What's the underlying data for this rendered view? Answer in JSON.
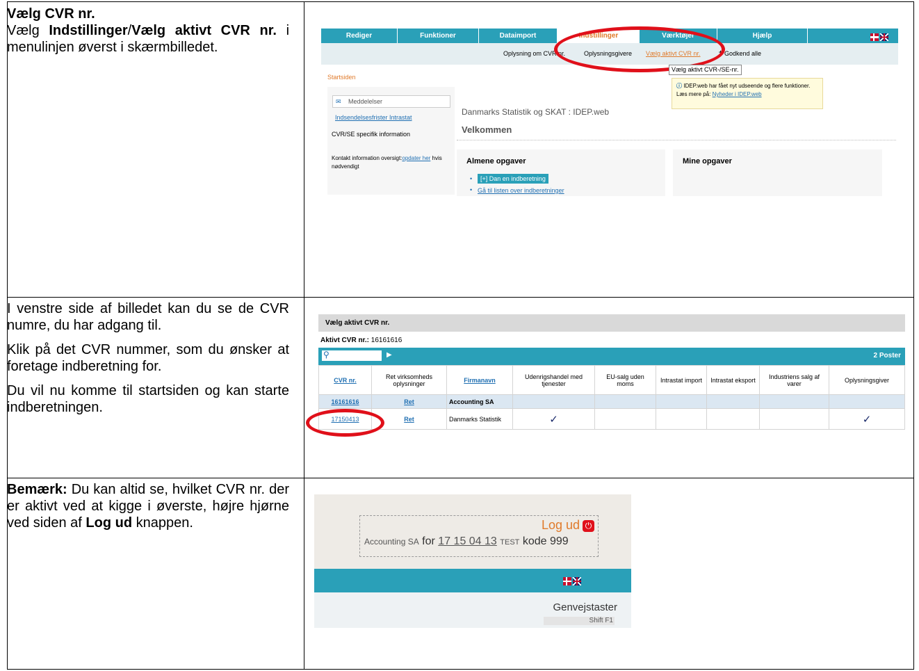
{
  "row1": {
    "heading": "Vælg CVR nr.",
    "pre": "Vælg ",
    "b1": "Indstillinger",
    "slash": "/",
    "b2": "Vælg aktivt CVR nr.",
    "post": " i menulinjen øverst i skærmbilledet."
  },
  "row2": {
    "p1": "I venstre side af billedet kan du se de CVR numre, du har adgang til.",
    "p2": "Klik på det CVR nummer, som du ønsker at foretage indberetning for.",
    "p3": "Du vil nu komme til startsiden og kan starte indberetningen."
  },
  "row3": {
    "b": "Bemærk:",
    "text1": " Du kan altid se, hvilket CVR nr. der er aktivt ved at kigge i øverste, højre hjørne ved siden af ",
    "b2": "Log ud",
    "text2": " knappen."
  },
  "shot1": {
    "tabs": [
      "Rediger",
      "Funktioner",
      "Dataimport",
      "Indstillinger",
      "Værktøjer",
      "Hjælp"
    ],
    "submenu": [
      "Oplysning om CVR nr.",
      "Oplysningsgivere",
      "Vælg aktivt CVR nr.",
      "Godkend alle"
    ],
    "tooltip": "Vælg aktivt CVR-/SE-nr.",
    "notice": "IDEP.web har fået nyt udseende og flere funktioner. Læs mere på:",
    "notice_link": "Nyheder i IDEP.web",
    "startsiden": "Startsiden",
    "meddelelser": "Meddelelser",
    "frister": "Indsendelsesfrister Intrastat",
    "cvrse": "CVR/SE specifik information",
    "kontakt_pre": "Kontakt information oversigt:",
    "kontakt_link": "opdater her",
    "kontakt_post": " hvis nødvendigt",
    "site_title": "Danmarks Statistik og SKAT : IDEP.web",
    "welcome": "Velkommen",
    "almene": "Almene opgaver",
    "dan": "[+] Dan en indberetning",
    "gaa": "Gå til listen over indberetninger",
    "mine": "Mine opgaver"
  },
  "shot2": {
    "title": "Vælg aktivt CVR nr.",
    "aktiv_label": "Aktivt CVR nr.:",
    "aktiv_value": "16161616",
    "poster": "2 Poster",
    "headers": [
      "CVR nr.",
      "Ret virksomheds oplysninger",
      "Firmanavn",
      "Udenrigshandel med tjenester",
      "EU-salg uden moms",
      "Intrastat import",
      "Intrastat eksport",
      "Industriens salg af varer",
      "Oplysningsgiver"
    ],
    "rows": [
      {
        "cvr": "16161616",
        "ret": "Ret",
        "firma": "Accounting SA",
        "checks": [
          "",
          "",
          "",
          "",
          "",
          ""
        ]
      },
      {
        "cvr": "17150413",
        "ret": "Ret",
        "firma": "Danmarks Statistik",
        "checks": [
          "✓",
          "",
          "",
          "",
          "",
          "✓"
        ]
      }
    ]
  },
  "shot3": {
    "logud": "Log ud",
    "company": "Accounting SA",
    "for": "for",
    "cvr": "17 15 04 13",
    "test": "TEST",
    "kode": "kode 999",
    "genvej": "Genvejstaster",
    "shift": "Shift F1"
  },
  "colors": {
    "teal": "#2aa0b8",
    "orange": "#e07a2a",
    "red": "#e0101a",
    "link": "#1f6fb2"
  }
}
